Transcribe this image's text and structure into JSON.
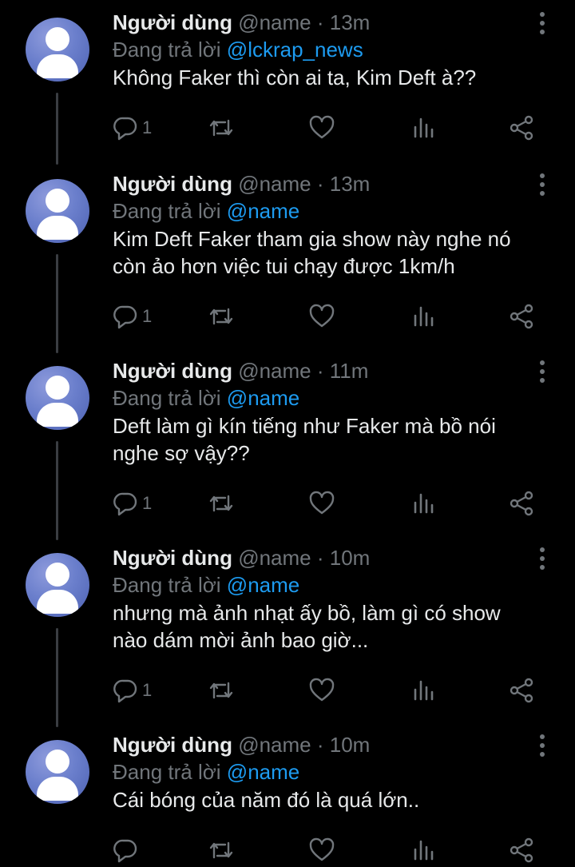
{
  "colors": {
    "background": "#000000",
    "text": "#e7e9ea",
    "muted": "#71767b",
    "mention": "#1d9bf0"
  },
  "labels": {
    "dot": "·",
    "replying": "Đang trả lời"
  },
  "tweets": [
    {
      "name": "Người dùng",
      "handle": "@name",
      "time": "13m",
      "reply_to": "@lckrap_news",
      "text": "Không Faker thì còn ai ta, Kim Deft à??",
      "replies": "1",
      "icons": [
        "reply-icon",
        "retweet-icon",
        "like-icon",
        "views-icon",
        "share-icon"
      ]
    },
    {
      "name": "Người dùng",
      "handle": "@name",
      "time": "13m",
      "reply_to": "@name",
      "text": "Kim Deft Faker tham gia show này nghe nó\ncòn ảo hơn việc tui chạy được 1km/h",
      "replies": "1"
    },
    {
      "name": "Người dùng",
      "handle": "@name",
      "time": "11m",
      "reply_to": "@name",
      "text": "Deft làm gì kín tiếng như Faker mà bồ nói\nnghe sợ vậy??",
      "replies": "1"
    },
    {
      "name": "Người dùng",
      "handle": "@name",
      "time": "10m",
      "reply_to": "@name",
      "text": "nhưng mà ảnh nhạt ấy bồ, làm gì có show\nnào dám mời ảnh bao giờ...",
      "replies": "1"
    },
    {
      "name": "Người dùng",
      "handle": "@name",
      "time": "10m",
      "reply_to": "@name",
      "text": "Cái bóng của năm đó là quá lớn..",
      "replies": ""
    }
  ]
}
